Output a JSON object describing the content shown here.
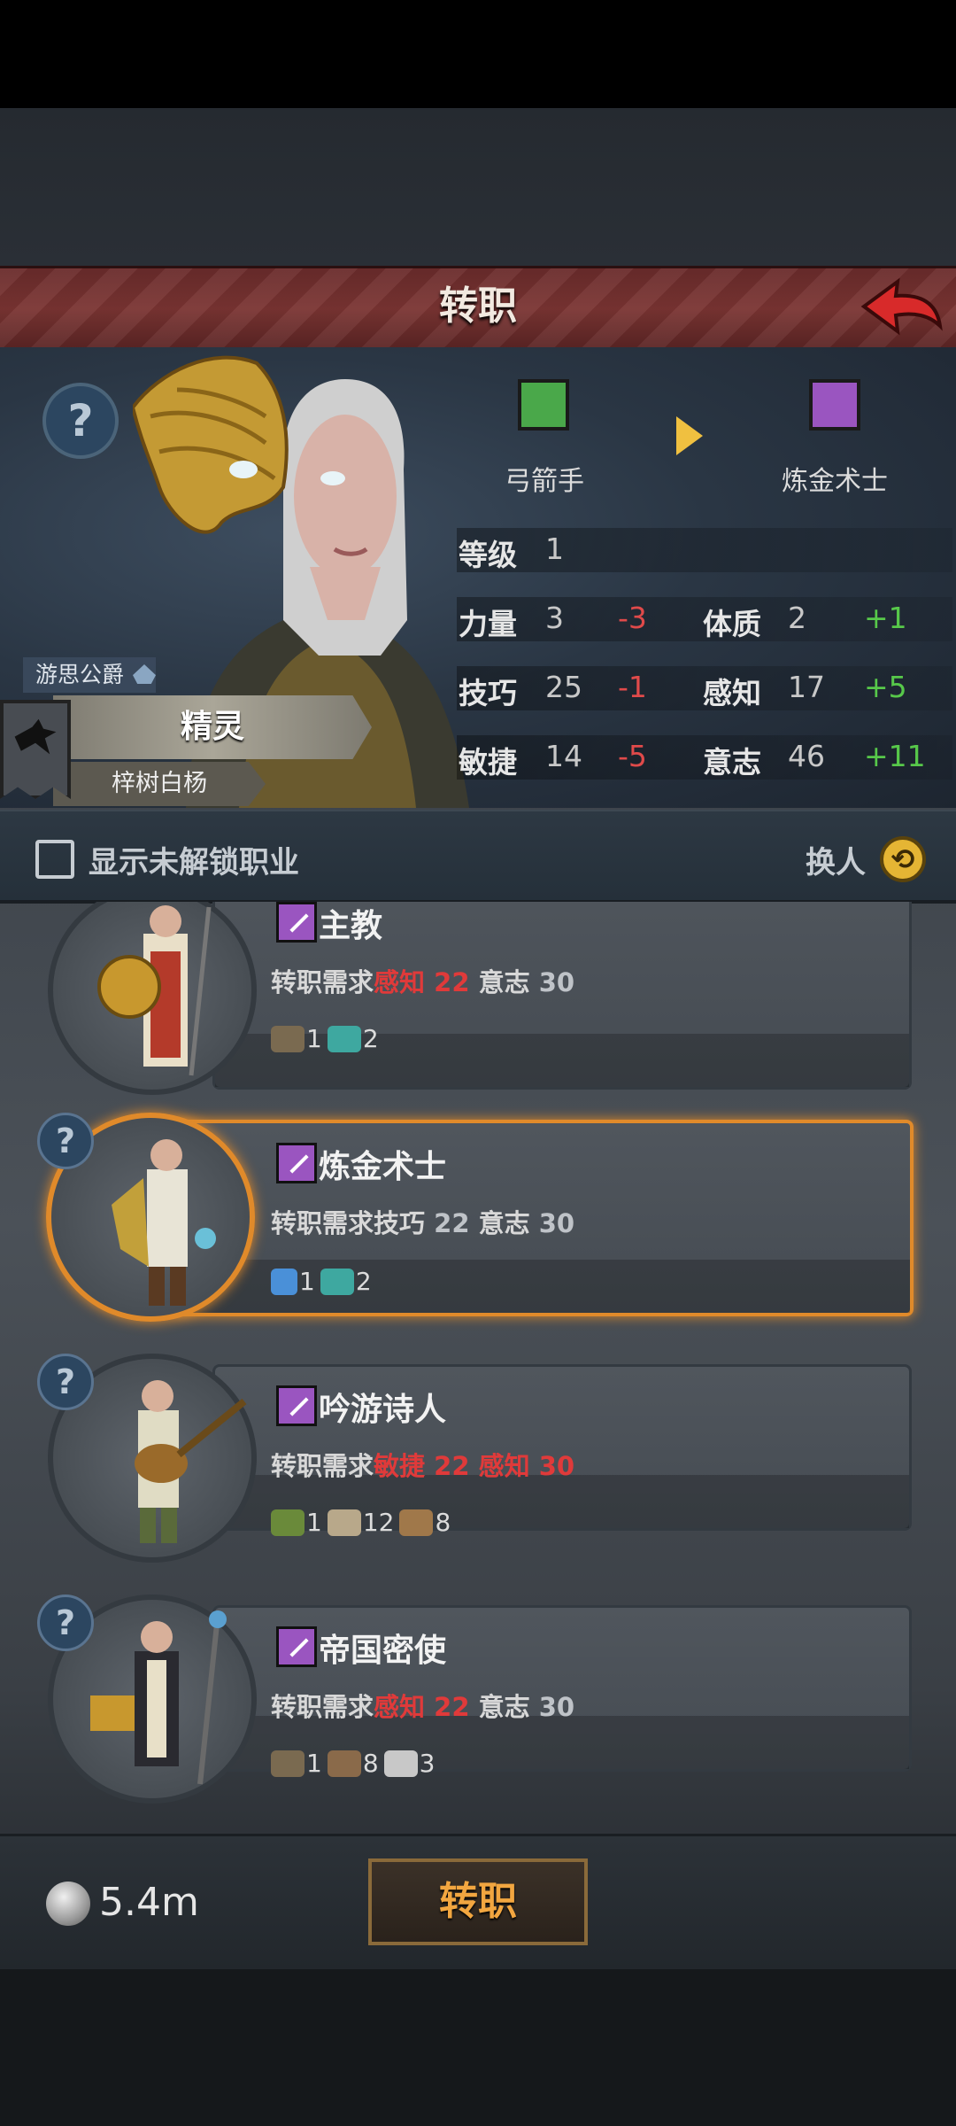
{
  "header": {
    "title": "转职"
  },
  "class_switch": {
    "from": "弓箭手",
    "to": "炼金术士",
    "arrow": "▶"
  },
  "stats": {
    "level_label": "等级",
    "level_value": "1",
    "rows": [
      {
        "a_name": "力量",
        "a_val": "3",
        "a_delta": "-3",
        "b_name": "体质",
        "b_val": "2",
        "b_delta": "+1"
      },
      {
        "a_name": "技巧",
        "a_val": "25",
        "a_delta": "-1",
        "b_name": "感知",
        "b_val": "17",
        "b_delta": "+5"
      },
      {
        "a_name": "敏捷",
        "a_val": "14",
        "a_delta": "-5",
        "b_name": "意志",
        "b_val": "46",
        "b_delta": "+11"
      }
    ]
  },
  "character": {
    "title": "游思公爵",
    "race": "精灵",
    "name": "梓树白杨"
  },
  "filter": {
    "label": "显示未解锁职业",
    "switch_label": "换人"
  },
  "help_glyph": "?",
  "classes": [
    {
      "name": "主教",
      "req_label": "转职需求",
      "req1_name": "感知",
      "req1_val": "22",
      "req2_name": "意志",
      "req2_val": "30",
      "mats": [
        "1",
        "2"
      ]
    },
    {
      "name": "炼金术士",
      "req_label": "转职需求",
      "req1_name": "技巧",
      "req1_val": "22",
      "req2_name": "意志",
      "req2_val": "30",
      "mats": [
        "1",
        "2"
      ]
    },
    {
      "name": "吟游诗人",
      "req_label": "转职需求",
      "req1_name": "敏捷",
      "req1_val": "22",
      "req2_name": "感知",
      "req2_val": "30",
      "mats": [
        "1",
        "12",
        "8"
      ]
    },
    {
      "name": "帝国密使",
      "req_label": "转职需求",
      "req1_name": "感知",
      "req1_val": "22",
      "req2_name": "意志",
      "req2_val": "30",
      "mats": [
        "1",
        "8",
        "3"
      ]
    }
  ],
  "footer": {
    "currency": "5.4m",
    "button": "转职"
  },
  "colors": {
    "accent": "#e08a2a",
    "title_bar": "#7a3432",
    "negative": "#e04a4a",
    "positive": "#57c84a"
  }
}
